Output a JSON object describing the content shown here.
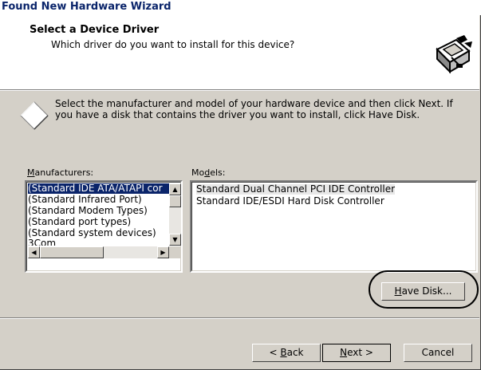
{
  "window": {
    "title": "Found New Hardware Wizard"
  },
  "header": {
    "title": "Select a Device Driver",
    "subtitle": "Which driver do you want to install for this device?",
    "icon": "hardware-wizard-icon"
  },
  "instructions": "Select the manufacturer and model of your hardware device and then click Next. If you have a disk that contains the driver you want to install, click Have Disk.",
  "manufacturers": {
    "label_pre": "",
    "label_key": "M",
    "label_post": "anufacturers:",
    "items": [
      "(Standard IDE ATA/ATAPI cor",
      "(Standard Infrared Port)",
      "(Standard Modem Types)",
      "(Standard port types)",
      "(Standard system devices)",
      "3Com"
    ],
    "selected_index": 0
  },
  "models": {
    "label_pre": "Mo",
    "label_key": "d",
    "label_post": "els:",
    "items": [
      "Standard Dual Channel PCI IDE Controller",
      "Standard IDE/ESDI Hard Disk Controller"
    ]
  },
  "buttons": {
    "have_disk": {
      "key": "H",
      "rest": "ave Disk..."
    },
    "back": {
      "pre": "< ",
      "key": "B",
      "rest": "ack"
    },
    "next": {
      "key": "N",
      "rest": "ext >"
    },
    "cancel": "Cancel"
  },
  "colors": {
    "selection": "#0a246a",
    "title_text": "#0a246a",
    "dialog_bg": "#d4d0c8"
  }
}
